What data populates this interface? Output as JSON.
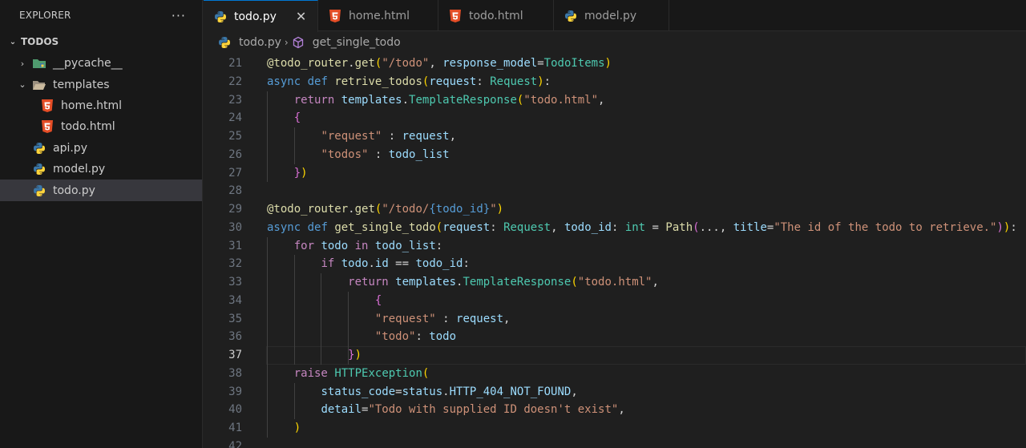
{
  "explorer": {
    "title": "EXPLORER",
    "more": "···",
    "root": "TODOS",
    "items": [
      {
        "label": "__pycache__",
        "type": "folder"
      },
      {
        "label": "templates",
        "type": "folder-open"
      },
      {
        "label": "home.html",
        "type": "html"
      },
      {
        "label": "todo.html",
        "type": "html"
      },
      {
        "label": "api.py",
        "type": "python"
      },
      {
        "label": "model.py",
        "type": "python"
      },
      {
        "label": "todo.py",
        "type": "python"
      }
    ]
  },
  "tabs": [
    {
      "label": "todo.py",
      "icon": "python-icon"
    },
    {
      "label": "home.html",
      "icon": "html5-icon"
    },
    {
      "label": "todo.html",
      "icon": "html5-icon"
    },
    {
      "label": "model.py",
      "icon": "python-icon"
    }
  ],
  "tab_close": "✕",
  "breadcrumb": {
    "file": "todo.py",
    "symbol": "get_single_todo"
  },
  "editor": {
    "current_line": 37,
    "lines": [
      {
        "n": "21",
        "t": [
          [
            "fn",
            "@todo_router"
          ],
          [
            "plain",
            "."
          ],
          [
            "fn",
            "get"
          ],
          [
            "br1",
            "("
          ],
          [
            "str",
            "\"/todo\""
          ],
          [
            "plain",
            ", "
          ],
          [
            "var",
            "response_model"
          ],
          [
            "plain",
            "="
          ],
          [
            "cls",
            "TodoItems"
          ],
          [
            "br1",
            ")"
          ]
        ]
      },
      {
        "n": "22",
        "t": [
          [
            "kw",
            "async"
          ],
          [
            "plain",
            " "
          ],
          [
            "kw",
            "def"
          ],
          [
            "plain",
            " "
          ],
          [
            "fn",
            "retrive_todos"
          ],
          [
            "br1",
            "("
          ],
          [
            "var",
            "request"
          ],
          [
            "plain",
            ": "
          ],
          [
            "cls",
            "Request"
          ],
          [
            "br1",
            ")"
          ],
          [
            "plain",
            ":"
          ]
        ]
      },
      {
        "n": "23",
        "t": [
          [
            "plain",
            "    "
          ],
          [
            "ctrl",
            "return"
          ],
          [
            "plain",
            " "
          ],
          [
            "var",
            "templates"
          ],
          [
            "plain",
            "."
          ],
          [
            "cls",
            "TemplateResponse"
          ],
          [
            "br1",
            "("
          ],
          [
            "str",
            "\"todo.html\""
          ],
          [
            "plain",
            ","
          ]
        ]
      },
      {
        "n": "24",
        "t": [
          [
            "plain",
            "    "
          ],
          [
            "br2",
            "{"
          ]
        ]
      },
      {
        "n": "25",
        "t": [
          [
            "plain",
            "        "
          ],
          [
            "str",
            "\"request\""
          ],
          [
            "plain",
            " : "
          ],
          [
            "var",
            "request"
          ],
          [
            "plain",
            ","
          ]
        ]
      },
      {
        "n": "26",
        "t": [
          [
            "plain",
            "        "
          ],
          [
            "str",
            "\"todos\""
          ],
          [
            "plain",
            " : "
          ],
          [
            "var",
            "todo_list"
          ]
        ]
      },
      {
        "n": "27",
        "t": [
          [
            "plain",
            "    "
          ],
          [
            "br2",
            "}"
          ],
          [
            "br1",
            ")"
          ]
        ]
      },
      {
        "n": "28",
        "t": []
      },
      {
        "n": "29",
        "t": [
          [
            "fn",
            "@todo_router"
          ],
          [
            "plain",
            "."
          ],
          [
            "fn",
            "get"
          ],
          [
            "br1",
            "("
          ],
          [
            "str",
            "\"/todo/"
          ],
          [
            "kw",
            "{todo_id}"
          ],
          [
            "str",
            "\""
          ],
          [
            "br1",
            ")"
          ]
        ]
      },
      {
        "n": "30",
        "t": [
          [
            "kw",
            "async"
          ],
          [
            "plain",
            " "
          ],
          [
            "kw",
            "def"
          ],
          [
            "plain",
            " "
          ],
          [
            "fn",
            "get_single_todo"
          ],
          [
            "br1",
            "("
          ],
          [
            "var",
            "request"
          ],
          [
            "plain",
            ": "
          ],
          [
            "cls",
            "Request"
          ],
          [
            "plain",
            ", "
          ],
          [
            "var",
            "todo_id"
          ],
          [
            "plain",
            ": "
          ],
          [
            "cls",
            "int"
          ],
          [
            "plain",
            " = "
          ],
          [
            "fn",
            "Path"
          ],
          [
            "br2",
            "("
          ],
          [
            "plain",
            "..., "
          ],
          [
            "var",
            "title"
          ],
          [
            "plain",
            "="
          ],
          [
            "str",
            "\"The id of the todo to retrieve.\""
          ],
          [
            "br2",
            ")"
          ],
          [
            "br1",
            ")"
          ],
          [
            "plain",
            ":"
          ]
        ]
      },
      {
        "n": "31",
        "t": [
          [
            "plain",
            "    "
          ],
          [
            "ctrl",
            "for"
          ],
          [
            "plain",
            " "
          ],
          [
            "var",
            "todo"
          ],
          [
            "plain",
            " "
          ],
          [
            "ctrl",
            "in"
          ],
          [
            "plain",
            " "
          ],
          [
            "var",
            "todo_list"
          ],
          [
            "plain",
            ":"
          ]
        ]
      },
      {
        "n": "32",
        "t": [
          [
            "plain",
            "        "
          ],
          [
            "ctrl",
            "if"
          ],
          [
            "plain",
            " "
          ],
          [
            "var",
            "todo"
          ],
          [
            "plain",
            "."
          ],
          [
            "var",
            "id"
          ],
          [
            "plain",
            " == "
          ],
          [
            "var",
            "todo_id"
          ],
          [
            "plain",
            ":"
          ]
        ]
      },
      {
        "n": "33",
        "t": [
          [
            "plain",
            "            "
          ],
          [
            "ctrl",
            "return"
          ],
          [
            "plain",
            " "
          ],
          [
            "var",
            "templates"
          ],
          [
            "plain",
            "."
          ],
          [
            "cls",
            "TemplateResponse"
          ],
          [
            "br1",
            "("
          ],
          [
            "str",
            "\"todo.html\""
          ],
          [
            "plain",
            ","
          ]
        ]
      },
      {
        "n": "34",
        "t": [
          [
            "plain",
            "                "
          ],
          [
            "br2",
            "{"
          ]
        ]
      },
      {
        "n": "35",
        "t": [
          [
            "plain",
            "                "
          ],
          [
            "str",
            "\"request\""
          ],
          [
            "plain",
            " : "
          ],
          [
            "var",
            "request"
          ],
          [
            "plain",
            ","
          ]
        ]
      },
      {
        "n": "36",
        "t": [
          [
            "plain",
            "                "
          ],
          [
            "str",
            "\"todo\""
          ],
          [
            "plain",
            ": "
          ],
          [
            "var",
            "todo"
          ]
        ]
      },
      {
        "n": "37",
        "t": [
          [
            "plain",
            "            "
          ],
          [
            "br2",
            "}"
          ],
          [
            "br1",
            ")"
          ]
        ]
      },
      {
        "n": "38",
        "t": [
          [
            "plain",
            "    "
          ],
          [
            "ctrl",
            "raise"
          ],
          [
            "plain",
            " "
          ],
          [
            "cls",
            "HTTPException"
          ],
          [
            "br1",
            "("
          ]
        ]
      },
      {
        "n": "39",
        "t": [
          [
            "plain",
            "        "
          ],
          [
            "var",
            "status_code"
          ],
          [
            "plain",
            "="
          ],
          [
            "var",
            "status"
          ],
          [
            "plain",
            "."
          ],
          [
            "var",
            "HTTP_404_NOT_FOUND"
          ],
          [
            "plain",
            ","
          ]
        ]
      },
      {
        "n": "40",
        "t": [
          [
            "plain",
            "        "
          ],
          [
            "var",
            "detail"
          ],
          [
            "plain",
            "="
          ],
          [
            "str",
            "\"Todo with supplied ID doesn't exist\""
          ],
          [
            "plain",
            ","
          ]
        ]
      },
      {
        "n": "41",
        "t": [
          [
            "plain",
            "    "
          ],
          [
            "br1",
            ")"
          ]
        ]
      },
      {
        "n": "42",
        "t": []
      }
    ]
  },
  "colors": {
    "accent": "#0078d4",
    "python_blue": "#3b77a8",
    "python_yellow": "#ffd43b",
    "html_orange": "#e44d26"
  }
}
